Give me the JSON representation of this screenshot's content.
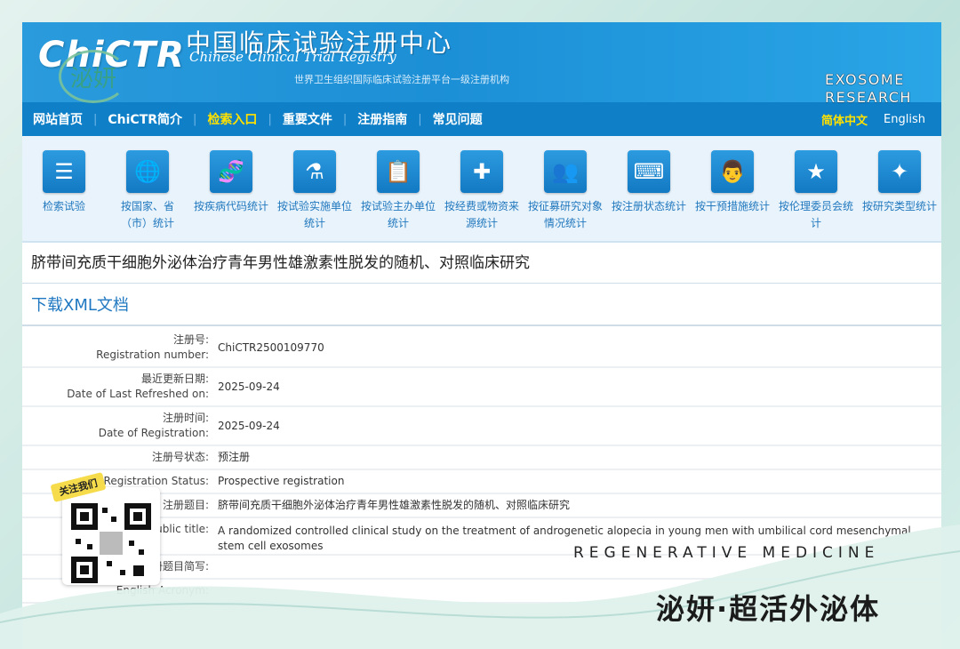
{
  "header": {
    "logo": "ChiCTR",
    "title_cn": "中国临床试验注册中心",
    "title_en": "Chinese Clinical Trial Registry",
    "subtitle": "世界卫生组织国际临床试验注册平台一级注册机构"
  },
  "nav": {
    "items": [
      "网站首页",
      "ChiCTR简介",
      "检索入口",
      "重要文件",
      "注册指南",
      "常见问题"
    ],
    "active_index": 2,
    "lang_cn": "简体中文",
    "lang_en": "English"
  },
  "icons": [
    {
      "icon": "list-icon",
      "glyph": "☰",
      "label": "检索试验"
    },
    {
      "icon": "world-map-icon",
      "glyph": "🌐",
      "label": "按国家、省（市）统计"
    },
    {
      "icon": "dna-icon",
      "glyph": "🧬",
      "label": "按疾病代码统计"
    },
    {
      "icon": "flask-icon",
      "glyph": "⚗",
      "label": "按试验实施单位统计"
    },
    {
      "icon": "clipboard-icon",
      "glyph": "📋",
      "label": "按试验主办单位统计"
    },
    {
      "icon": "medical-kit-icon",
      "glyph": "✚",
      "label": "按经费或物资来源统计"
    },
    {
      "icon": "people-icon",
      "glyph": "👥",
      "label": "按征募研究对象情况统计"
    },
    {
      "icon": "keyboard-icon",
      "glyph": "⌨",
      "label": "按注册状态统计"
    },
    {
      "icon": "doctor-icon",
      "glyph": "👨",
      "label": "按干预措施统计"
    },
    {
      "icon": "star-icon",
      "glyph": "★",
      "label": "按伦理委员会统计"
    },
    {
      "icon": "sparkle-icon",
      "glyph": "✦",
      "label": "按研究类型统计"
    }
  ],
  "study_title": "脐带间充质干细胞外泌体治疗青年男性雄激素性脱发的随机、对照临床研究",
  "download_label": "下载XML文档",
  "fields": [
    {
      "label_cn": "注册号:",
      "label_en": "Registration number:",
      "value": "ChiCTR2500109770"
    },
    {
      "label_cn": "最近更新日期:",
      "label_en": "Date of Last Refreshed on:",
      "value": "2025-09-24"
    },
    {
      "label_cn": "注册时间:",
      "label_en": "Date of Registration:",
      "value": "2025-09-24"
    },
    {
      "label_cn": "注册号状态:",
      "label_en": "",
      "value": "预注册"
    },
    {
      "label_cn": "",
      "label_en": "Registration Status:",
      "value": "Prospective registration"
    },
    {
      "label_cn": "注册题目:",
      "label_en": "",
      "value": "脐带间充质干细胞外泌体治疗青年男性雄激素性脱发的随机、对照临床研究"
    },
    {
      "label_cn": "",
      "label_en": "Public title:",
      "value": "A randomized controlled clinical study on the treatment of androgenetic alopecia in young men with umbilical cord mesenchymal stem cell exosomes"
    },
    {
      "label_cn": "注册题目简写:",
      "label_en": "",
      "value": ""
    },
    {
      "label_cn": "",
      "label_en": "English Acronym:",
      "value": ""
    }
  ],
  "overlay": {
    "brand_mark": "泌妍",
    "exosome_line1": "EXOSOME",
    "exosome_line2": "RESEARCH",
    "follow_tag": "关注我们",
    "regen": "REGENERATIVE MEDICINE",
    "brand_cn": "泌妍·超活外泌体"
  }
}
